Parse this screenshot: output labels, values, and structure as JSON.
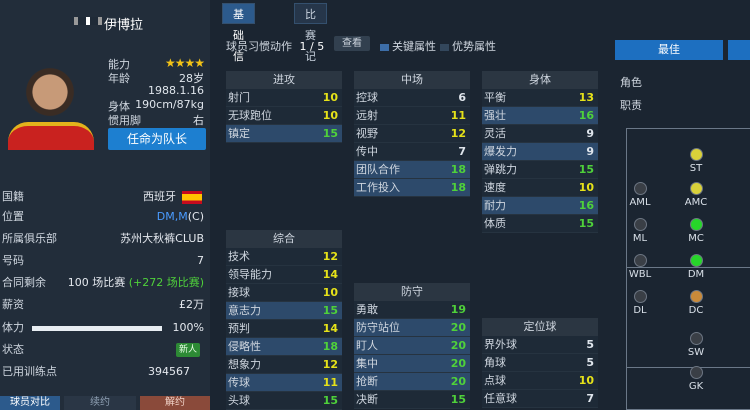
{
  "player": {
    "name": "伊博拉",
    "ability_label": "能力",
    "stars": "★★★★",
    "age_label": "年龄",
    "age": "28岁",
    "birth": "1988.1.16",
    "body_label": "身体",
    "body": "190cm/87kg",
    "foot_label": "惯用脚",
    "foot": "右",
    "captain_button": "任命为队长"
  },
  "info": {
    "nationality_label": "国籍",
    "nationality": "西班牙",
    "position_label": "位置",
    "position_main": "DM,M",
    "position_extra": "(C)",
    "club_label": "所属俱乐部",
    "club": "苏州大秋裤CLUB",
    "number_label": "号码",
    "number": "7",
    "contract_label": "合同剩余",
    "contract": "100 场比赛",
    "contract_bonus": "(+272 场比赛)",
    "salary_label": "薪资",
    "salary": "£2万",
    "stamina_label": "体力",
    "stamina": "100%",
    "stamina_fraction": 1.0,
    "status_label": "状态",
    "status_badge": "新人",
    "training_label": "已用训练点",
    "training": "394567"
  },
  "bottom_tabs": [
    "球员对比",
    "续约",
    "解约"
  ],
  "tabs": [
    "基础信息",
    "比赛记录"
  ],
  "toolbar": {
    "habit_label": "球员习惯动作",
    "habit_count": "1 / 5",
    "view_button": "查看",
    "legend_key": "关键属性",
    "legend_adv": "优势属性"
  },
  "attack": {
    "title": "进攻",
    "rows": [
      {
        "label": "射门",
        "value": "10",
        "color": "c-yel",
        "hl": false
      },
      {
        "label": "无球跑位",
        "value": "10",
        "color": "c-yel",
        "hl": false
      },
      {
        "label": "镇定",
        "value": "15",
        "color": "c-grn",
        "hl": true
      }
    ]
  },
  "midfield": {
    "title": "中场",
    "rows": [
      {
        "label": "控球",
        "value": "6",
        "color": "c-wht",
        "hl": false
      },
      {
        "label": "远射",
        "value": "11",
        "color": "c-yel",
        "hl": false
      },
      {
        "label": "视野",
        "value": "12",
        "color": "c-yel",
        "hl": false
      },
      {
        "label": "传中",
        "value": "7",
        "color": "c-wht",
        "hl": false
      },
      {
        "label": "团队合作",
        "value": "18",
        "color": "c-grn",
        "hl": true
      },
      {
        "label": "工作投入",
        "value": "18",
        "color": "c-grn",
        "hl": true
      }
    ]
  },
  "physical": {
    "title": "身体",
    "rows": [
      {
        "label": "平衡",
        "value": "13",
        "color": "c-yel",
        "hl": false
      },
      {
        "label": "强壮",
        "value": "16",
        "color": "c-grn",
        "hl": true
      },
      {
        "label": "灵活",
        "value": "9",
        "color": "c-wht",
        "hl": false
      },
      {
        "label": "爆发力",
        "value": "9",
        "color": "c-wht",
        "hl": true
      },
      {
        "label": "弹跳力",
        "value": "15",
        "color": "c-grn",
        "hl": false
      },
      {
        "label": "速度",
        "value": "10",
        "color": "c-yel",
        "hl": false
      },
      {
        "label": "耐力",
        "value": "16",
        "color": "c-grn",
        "hl": true
      },
      {
        "label": "体质",
        "value": "15",
        "color": "c-grn",
        "hl": false
      }
    ]
  },
  "general": {
    "title": "综合",
    "rows": [
      {
        "label": "技术",
        "value": "12",
        "color": "c-yel",
        "hl": false
      },
      {
        "label": "领导能力",
        "value": "14",
        "color": "c-yel",
        "hl": false
      },
      {
        "label": "接球",
        "value": "10",
        "color": "c-yel",
        "hl": false
      },
      {
        "label": "意志力",
        "value": "15",
        "color": "c-grn",
        "hl": true
      },
      {
        "label": "预判",
        "value": "14",
        "color": "c-yel",
        "hl": false
      },
      {
        "label": "侵略性",
        "value": "18",
        "color": "c-grn",
        "hl": true
      },
      {
        "label": "想象力",
        "value": "12",
        "color": "c-yel",
        "hl": false
      },
      {
        "label": "传球",
        "value": "11",
        "color": "c-yel",
        "hl": true
      },
      {
        "label": "头球",
        "value": "15",
        "color": "c-grn",
        "hl": false
      }
    ]
  },
  "defense": {
    "title": "防守",
    "rows": [
      {
        "label": "勇敢",
        "value": "19",
        "color": "c-grn",
        "hl": false
      },
      {
        "label": "防守站位",
        "value": "20",
        "color": "c-grn",
        "hl": true
      },
      {
        "label": "盯人",
        "value": "20",
        "color": "c-grn",
        "hl": true
      },
      {
        "label": "集中",
        "value": "20",
        "color": "c-grn",
        "hl": true
      },
      {
        "label": "抢断",
        "value": "20",
        "color": "c-grn",
        "hl": true
      },
      {
        "label": "决断",
        "value": "15",
        "color": "c-grn",
        "hl": false
      }
    ]
  },
  "setpiece": {
    "title": "定位球",
    "rows": [
      {
        "label": "界外球",
        "value": "5",
        "color": "c-wht",
        "hl": false
      },
      {
        "label": "角球",
        "value": "5",
        "color": "c-wht",
        "hl": false
      },
      {
        "label": "点球",
        "value": "10",
        "color": "c-yel",
        "hl": false
      },
      {
        "label": "任意球",
        "value": "7",
        "color": "c-wht",
        "hl": false
      }
    ]
  },
  "role": {
    "best_button": "最佳",
    "role_label": "角色",
    "duty_label": "职责"
  },
  "pitch_positions": [
    {
      "label": "ST",
      "color": "#d9d13a"
    },
    {
      "label": "AML",
      "color": "#3a3f46"
    },
    {
      "label": "AMC",
      "color": "#d9d13a"
    },
    {
      "label": "ML",
      "color": "#3a3f46"
    },
    {
      "label": "MC",
      "color": "#27d62a"
    },
    {
      "label": "WBL",
      "color": "#3a3f46"
    },
    {
      "label": "DM",
      "color": "#27d62a"
    },
    {
      "label": "DL",
      "color": "#3a3f46"
    },
    {
      "label": "DC",
      "color": "#c98a3a"
    },
    {
      "label": "SW",
      "color": "#3a3f46"
    },
    {
      "label": "GK",
      "color": "#3a3f46"
    }
  ],
  "colors": {
    "accent": "#1d7fd0",
    "key_attr": "#3d6ea8",
    "adv_attr": "#33475c"
  }
}
